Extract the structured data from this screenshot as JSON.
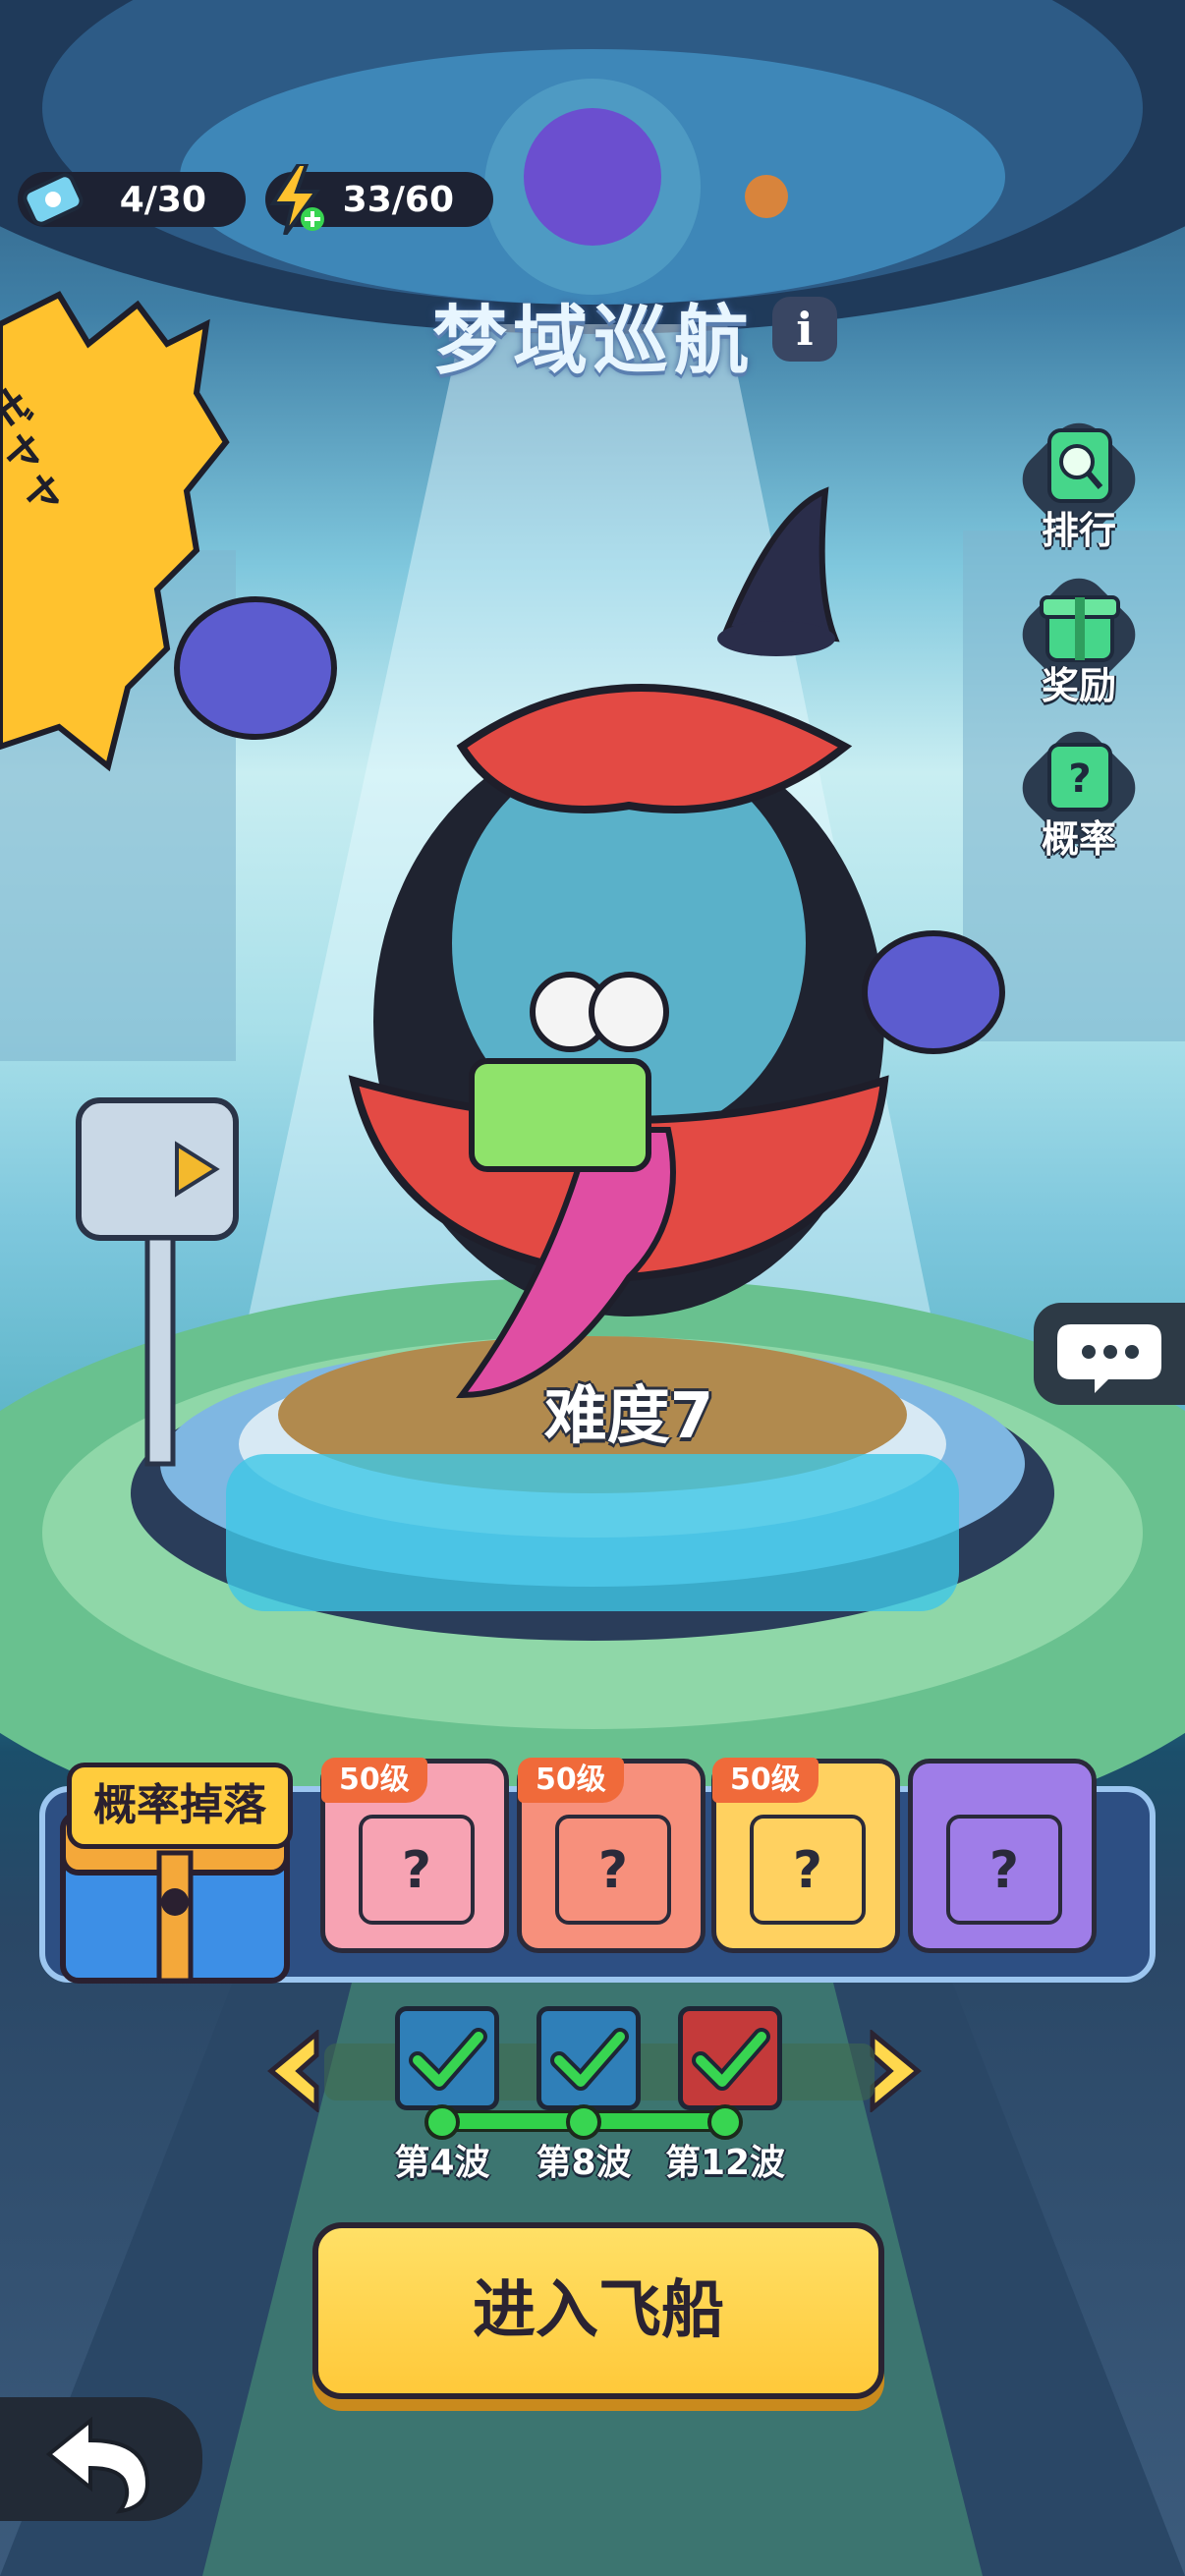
{
  "topbar": {
    "tickets": "4/30",
    "energy": "33/60"
  },
  "title": "梦域巡航",
  "info_label": "i",
  "side_menu": {
    "rank": "排行",
    "reward": "奖励",
    "rate": "概率"
  },
  "comic_text": "ギャャャ",
  "difficulty": "难度7",
  "drops": {
    "label": "概率掉落",
    "items": [
      {
        "level": "50级",
        "color": "#f7a3b3"
      },
      {
        "level": "50级",
        "color": "#f7907c"
      },
      {
        "level": "50级",
        "color": "#ffd160"
      },
      {
        "level": "",
        "color": "#9f7de8"
      }
    ]
  },
  "waves": [
    {
      "label": "第4波",
      "done": true
    },
    {
      "label": "第8波",
      "done": true
    },
    {
      "label": "第12波",
      "done": true
    }
  ],
  "enter_button": "进入飞船",
  "colors": {
    "accent_yellow": "#ffc93a",
    "panel_blue": "#2d4f83",
    "check_green": "#38d551"
  }
}
